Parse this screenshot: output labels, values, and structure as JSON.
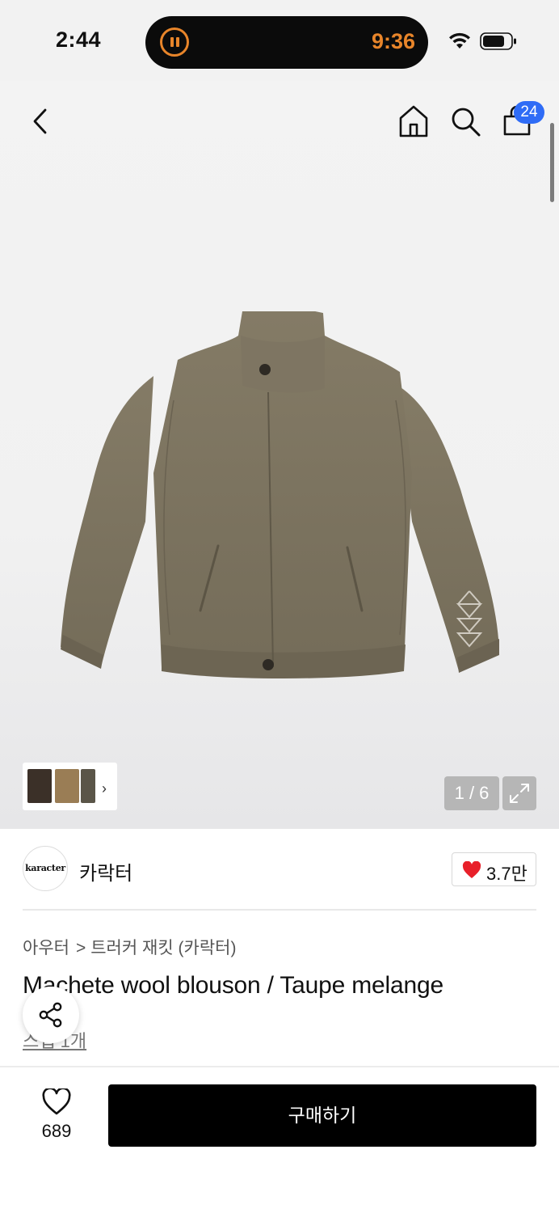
{
  "status_bar": {
    "time": "2:44",
    "timer": "9:36"
  },
  "header": {
    "cart_count": "24"
  },
  "gallery": {
    "page_indicator": "1 / 6",
    "thumb_colors": [
      "#3b3028",
      "#9a7d55",
      "#5a5548"
    ]
  },
  "brand": {
    "logo_text": "karacter",
    "name": "카락터",
    "likes": "3.7만"
  },
  "breadcrumb": {
    "category": "아우터",
    "separator": ">",
    "subcategory": "트러커 재킷 (카락터)"
  },
  "product": {
    "title": "Machete wool blouson / Taupe melange",
    "review_link": "스냅 1개"
  },
  "bottom_bar": {
    "wish_count": "689",
    "buy_label": "구매하기"
  },
  "colors": {
    "accent_badge": "#2f6cf6",
    "heart": "#e8202a",
    "buy_button": "#000000",
    "timer": "#e8852a",
    "jacket": "#7a725f"
  }
}
